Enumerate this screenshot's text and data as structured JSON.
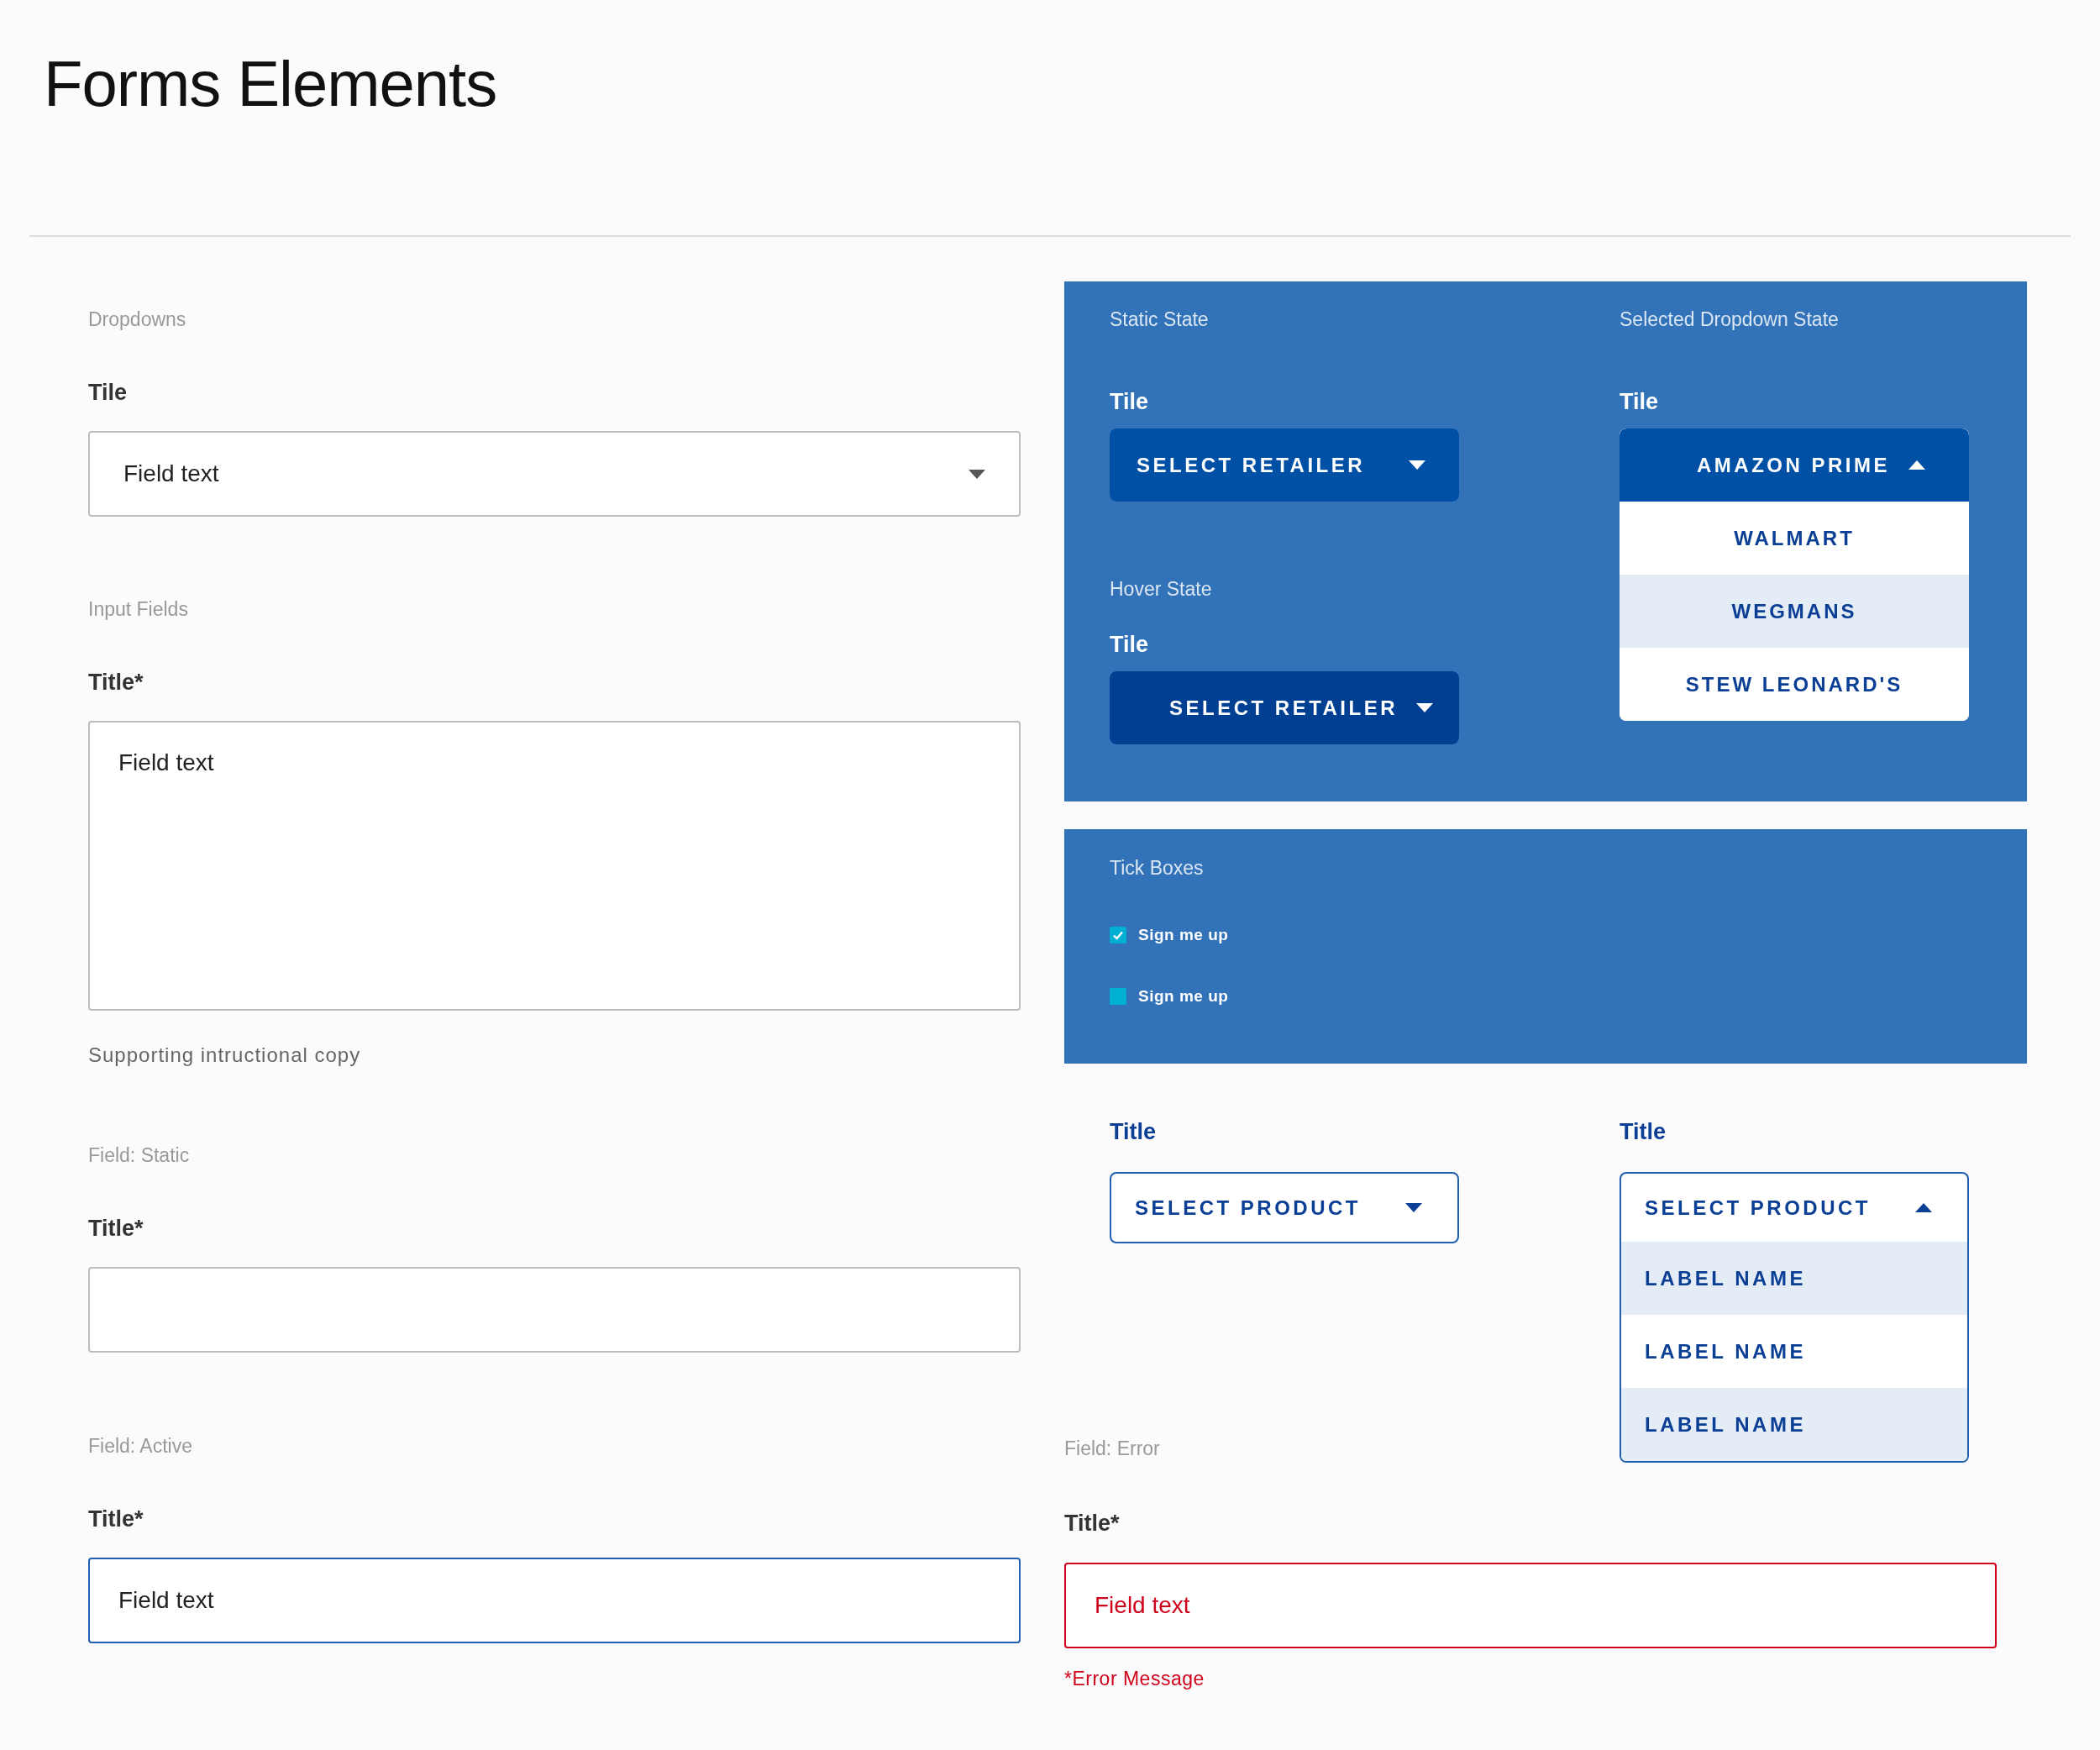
{
  "page_title": "Forms Elements",
  "dropdown_section": {
    "heading": "Dropdowns",
    "label": "Tile",
    "value": "Field text",
    "expanded": false
  },
  "input_section": {
    "heading": "Input Fields",
    "label": "Title*",
    "value": "Field text",
    "helper": "Supporting intructional copy"
  },
  "static_field": {
    "heading": "Field: Static",
    "label": "Title*"
  },
  "active_field": {
    "heading": "Field: Active",
    "label": "Title*",
    "value": "Field text"
  },
  "retailer_panel": {
    "static": {
      "heading": "Static State",
      "label": "Tile",
      "value": "SELECT RETAILER",
      "hovered": false,
      "expanded": false
    },
    "hover": {
      "heading": "Hover State",
      "label": "Tile",
      "value": "SELECT RETAILER",
      "hovered": true,
      "expanded": false
    },
    "selected": {
      "heading": "Selected Dropdown State",
      "label": "Tile",
      "value": "AMAZON PRIME",
      "hovered": false,
      "expanded": true,
      "options": [
        {
          "label": "WALMART",
          "highlighted": false
        },
        {
          "label": "WEGMANS",
          "highlighted": true
        },
        {
          "label": "STEW LEONARD'S",
          "highlighted": false
        }
      ]
    }
  },
  "tick_boxes": {
    "heading": "Tick Boxes",
    "items": [
      {
        "label": "Sign me up",
        "checked": true
      },
      {
        "label": "Sign me up",
        "checked": false
      }
    ]
  },
  "product_dropdowns": [
    {
      "label": "Title",
      "value": "SELECT PRODUCT",
      "expanded": false
    },
    {
      "label": "Title",
      "value": "SELECT PRODUCT",
      "expanded": true,
      "options": [
        {
          "label": "LABEL NAME",
          "highlighted": true
        },
        {
          "label": "LABEL NAME",
          "highlighted": false
        },
        {
          "label": "LABEL NAME",
          "highlighted": true
        }
      ]
    }
  ],
  "error_field": {
    "heading": "Field: Error",
    "label": "Title*",
    "value": "Field text",
    "error": "*Error Message"
  }
}
